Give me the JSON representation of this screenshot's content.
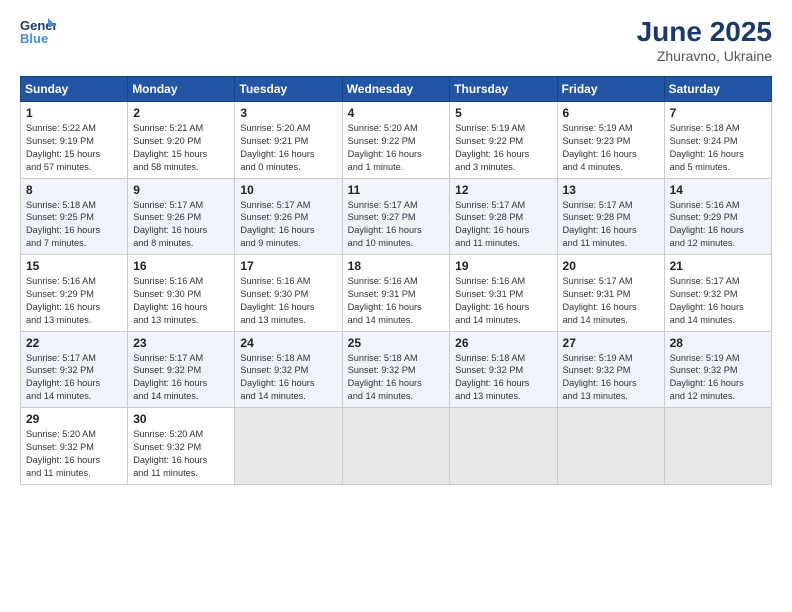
{
  "header": {
    "logo_line1": "General",
    "logo_line2": "Blue",
    "month": "June 2025",
    "location": "Zhuravno, Ukraine"
  },
  "weekdays": [
    "Sunday",
    "Monday",
    "Tuesday",
    "Wednesday",
    "Thursday",
    "Friday",
    "Saturday"
  ],
  "weeks": [
    [
      {
        "day": "1",
        "info": "Sunrise: 5:22 AM\nSunset: 9:19 PM\nDaylight: 15 hours\nand 57 minutes."
      },
      {
        "day": "2",
        "info": "Sunrise: 5:21 AM\nSunset: 9:20 PM\nDaylight: 15 hours\nand 58 minutes."
      },
      {
        "day": "3",
        "info": "Sunrise: 5:20 AM\nSunset: 9:21 PM\nDaylight: 16 hours\nand 0 minutes."
      },
      {
        "day": "4",
        "info": "Sunrise: 5:20 AM\nSunset: 9:22 PM\nDaylight: 16 hours\nand 1 minute."
      },
      {
        "day": "5",
        "info": "Sunrise: 5:19 AM\nSunset: 9:22 PM\nDaylight: 16 hours\nand 3 minutes."
      },
      {
        "day": "6",
        "info": "Sunrise: 5:19 AM\nSunset: 9:23 PM\nDaylight: 16 hours\nand 4 minutes."
      },
      {
        "day": "7",
        "info": "Sunrise: 5:18 AM\nSunset: 9:24 PM\nDaylight: 16 hours\nand 5 minutes."
      }
    ],
    [
      {
        "day": "8",
        "info": "Sunrise: 5:18 AM\nSunset: 9:25 PM\nDaylight: 16 hours\nand 7 minutes."
      },
      {
        "day": "9",
        "info": "Sunrise: 5:17 AM\nSunset: 9:26 PM\nDaylight: 16 hours\nand 8 minutes."
      },
      {
        "day": "10",
        "info": "Sunrise: 5:17 AM\nSunset: 9:26 PM\nDaylight: 16 hours\nand 9 minutes."
      },
      {
        "day": "11",
        "info": "Sunrise: 5:17 AM\nSunset: 9:27 PM\nDaylight: 16 hours\nand 10 minutes."
      },
      {
        "day": "12",
        "info": "Sunrise: 5:17 AM\nSunset: 9:28 PM\nDaylight: 16 hours\nand 11 minutes."
      },
      {
        "day": "13",
        "info": "Sunrise: 5:17 AM\nSunset: 9:28 PM\nDaylight: 16 hours\nand 11 minutes."
      },
      {
        "day": "14",
        "info": "Sunrise: 5:16 AM\nSunset: 9:29 PM\nDaylight: 16 hours\nand 12 minutes."
      }
    ],
    [
      {
        "day": "15",
        "info": "Sunrise: 5:16 AM\nSunset: 9:29 PM\nDaylight: 16 hours\nand 13 minutes."
      },
      {
        "day": "16",
        "info": "Sunrise: 5:16 AM\nSunset: 9:30 PM\nDaylight: 16 hours\nand 13 minutes."
      },
      {
        "day": "17",
        "info": "Sunrise: 5:16 AM\nSunset: 9:30 PM\nDaylight: 16 hours\nand 13 minutes."
      },
      {
        "day": "18",
        "info": "Sunrise: 5:16 AM\nSunset: 9:31 PM\nDaylight: 16 hours\nand 14 minutes."
      },
      {
        "day": "19",
        "info": "Sunrise: 5:16 AM\nSunset: 9:31 PM\nDaylight: 16 hours\nand 14 minutes."
      },
      {
        "day": "20",
        "info": "Sunrise: 5:17 AM\nSunset: 9:31 PM\nDaylight: 16 hours\nand 14 minutes."
      },
      {
        "day": "21",
        "info": "Sunrise: 5:17 AM\nSunset: 9:32 PM\nDaylight: 16 hours\nand 14 minutes."
      }
    ],
    [
      {
        "day": "22",
        "info": "Sunrise: 5:17 AM\nSunset: 9:32 PM\nDaylight: 16 hours\nand 14 minutes."
      },
      {
        "day": "23",
        "info": "Sunrise: 5:17 AM\nSunset: 9:32 PM\nDaylight: 16 hours\nand 14 minutes."
      },
      {
        "day": "24",
        "info": "Sunrise: 5:18 AM\nSunset: 9:32 PM\nDaylight: 16 hours\nand 14 minutes."
      },
      {
        "day": "25",
        "info": "Sunrise: 5:18 AM\nSunset: 9:32 PM\nDaylight: 16 hours\nand 14 minutes."
      },
      {
        "day": "26",
        "info": "Sunrise: 5:18 AM\nSunset: 9:32 PM\nDaylight: 16 hours\nand 13 minutes."
      },
      {
        "day": "27",
        "info": "Sunrise: 5:19 AM\nSunset: 9:32 PM\nDaylight: 16 hours\nand 13 minutes."
      },
      {
        "day": "28",
        "info": "Sunrise: 5:19 AM\nSunset: 9:32 PM\nDaylight: 16 hours\nand 12 minutes."
      }
    ],
    [
      {
        "day": "29",
        "info": "Sunrise: 5:20 AM\nSunset: 9:32 PM\nDaylight: 16 hours\nand 11 minutes."
      },
      {
        "day": "30",
        "info": "Sunrise: 5:20 AM\nSunset: 9:32 PM\nDaylight: 16 hours\nand 11 minutes."
      },
      null,
      null,
      null,
      null,
      null
    ]
  ]
}
